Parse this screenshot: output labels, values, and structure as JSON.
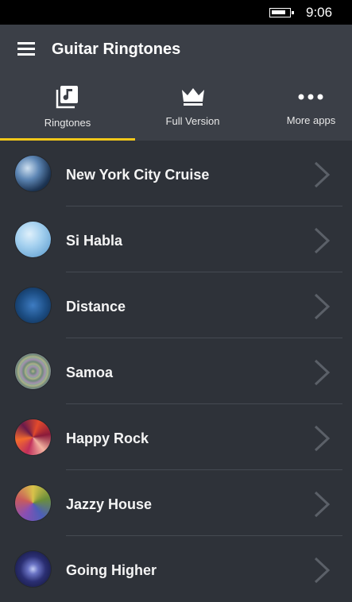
{
  "status_bar": {
    "time": "9:06"
  },
  "header": {
    "title": "Guitar Ringtones"
  },
  "tabs": [
    {
      "label": "Ringtones",
      "icon": "music-library-icon",
      "selected": true
    },
    {
      "label": "Full Version",
      "icon": "crown-icon",
      "selected": false
    },
    {
      "label": "More apps",
      "icon": "more-dots-icon",
      "selected": false
    }
  ],
  "ringtones": [
    {
      "name": "New York City Cruise"
    },
    {
      "name": "Si Habla"
    },
    {
      "name": "Distance"
    },
    {
      "name": "Samoa"
    },
    {
      "name": "Happy Rock"
    },
    {
      "name": "Jazzy House"
    },
    {
      "name": "Going Higher"
    }
  ],
  "colors": {
    "accent": "#f2c81a",
    "header_bg": "#3b3f47",
    "list_bg": "#2e3239"
  }
}
